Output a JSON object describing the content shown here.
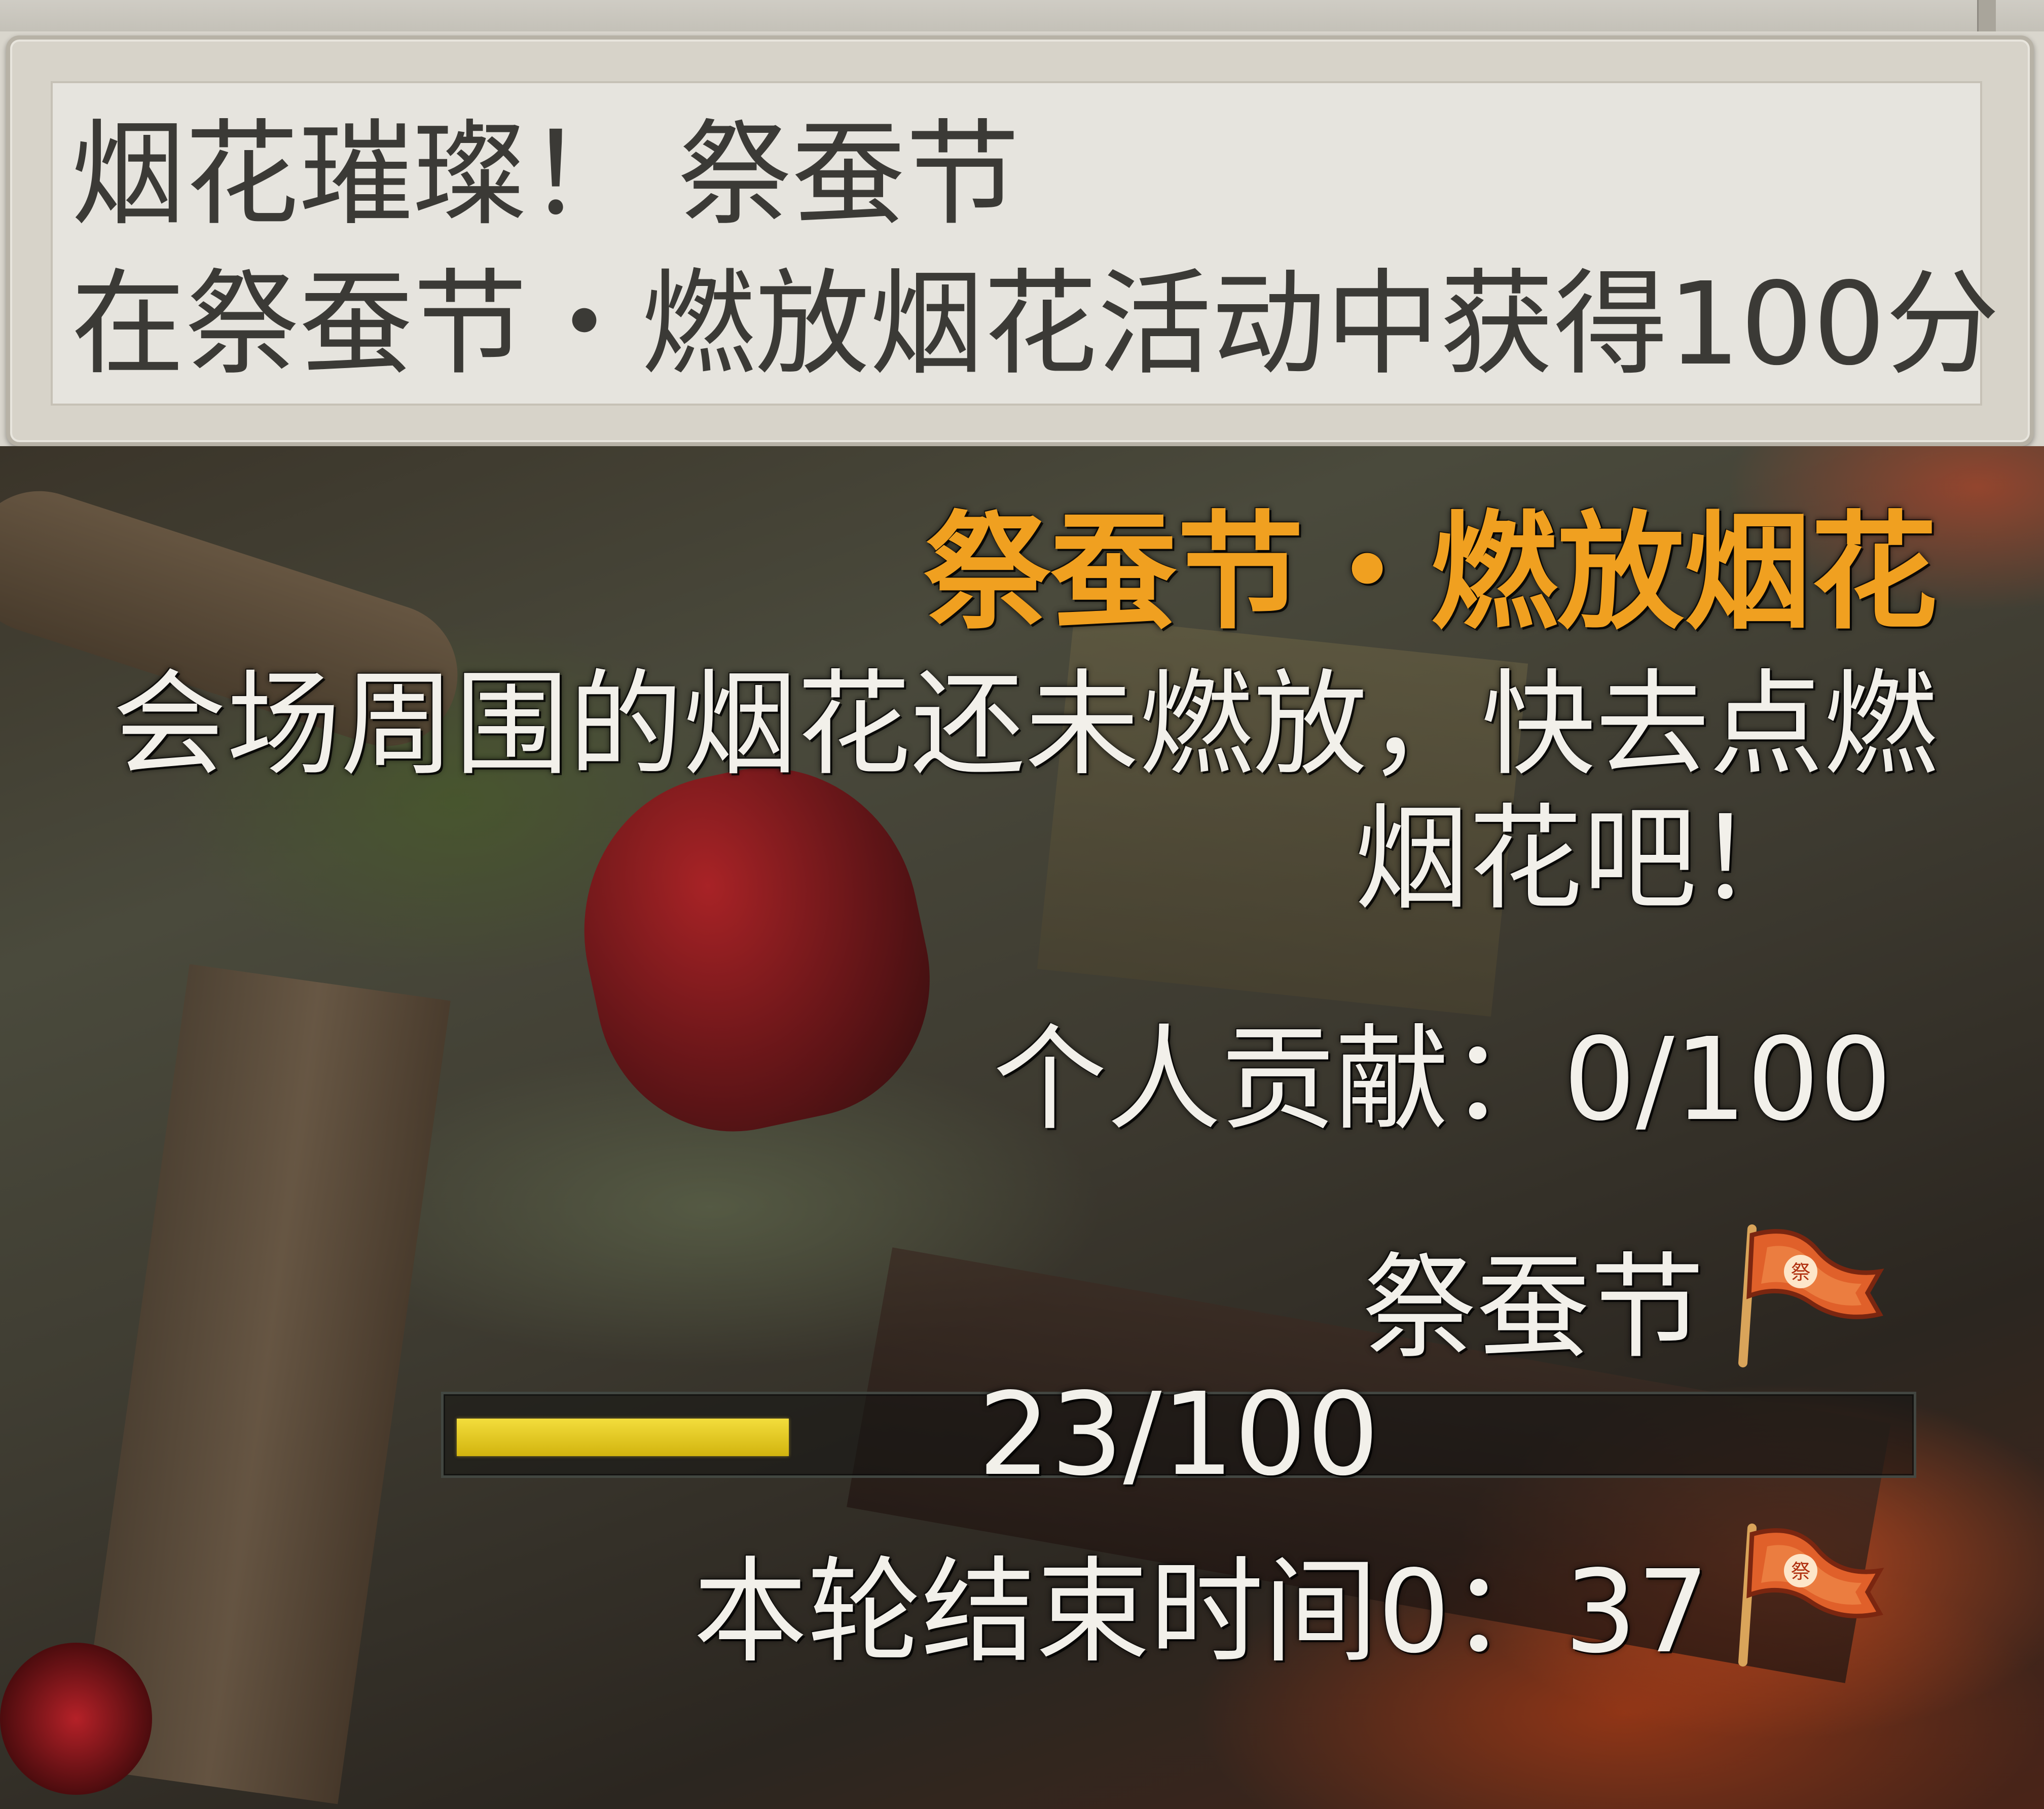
{
  "tooltip": {
    "title": "烟花璀璨！ 祭蚕节",
    "description": "在祭蚕节・燃放烟花活动中获得100分"
  },
  "event": {
    "title": "祭蚕节・燃放烟花",
    "description_line1": "会场周围的烟花还未燃放，快去点燃",
    "description_line2": "烟花吧！",
    "contribution_label": "个人贡献：0/100",
    "festival_label": "祭蚕节",
    "flag_icon": "festival-flag-icon",
    "progress_text": "23/100",
    "progress_fraction": 0.23,
    "timer_label": "本轮结束时间0：37"
  },
  "colors": {
    "event_title": "#f0a020",
    "progress_fill": "#e8ca1f"
  }
}
